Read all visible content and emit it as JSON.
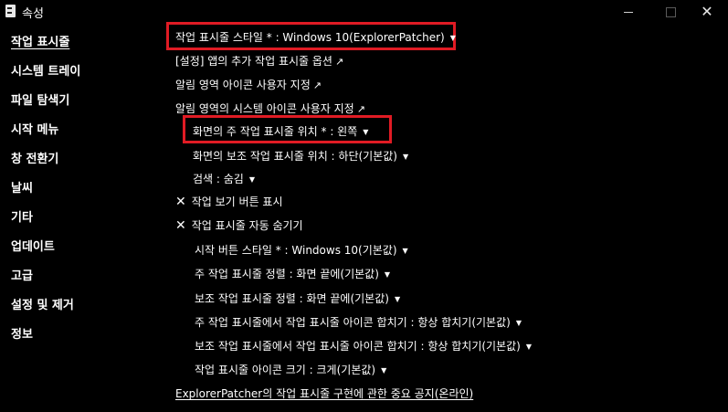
{
  "window": {
    "title": "속성",
    "close_glyph": "✕"
  },
  "sidebar": {
    "items": [
      {
        "label": "작업 표시줄",
        "active": true
      },
      {
        "label": "시스템 트레이"
      },
      {
        "label": "파일 탐색기"
      },
      {
        "label": "시작 메뉴"
      },
      {
        "label": "창 전환기"
      },
      {
        "label": "날씨"
      },
      {
        "label": "기타"
      },
      {
        "label": "업데이트"
      },
      {
        "label": "고급"
      },
      {
        "label": "설정 및 제거"
      },
      {
        "label": "정보"
      }
    ]
  },
  "options": {
    "taskbar_style": "작업 표시줄 스타일 * : Windows 10(ExplorerPatcher)",
    "app_taskbar_options": "[설정] 앱의 추가 작업 표시줄 옵션",
    "notification_icons": "알림 영역 아이콘 사용자 지정",
    "notification_system_icons": "알림 영역의 시스템 아이콘 사용자 지정",
    "primary_taskbar_position": "화면의 주 작업 표시줄 위치 * : 왼쪽",
    "secondary_taskbar_position": "화면의 보조 작업 표시줄 위치 : 하단(기본값)",
    "search": "검색 : 숨김",
    "task_view_button": "작업 보기 버튼 표시",
    "auto_hide_taskbar": "작업 표시줄 자동 숨기기",
    "start_button_style": "시작 버튼 스타일 * : Windows 10(기본값)",
    "primary_alignment": "주 작업 표시줄 정렬 : 화면 끝에(기본값)",
    "secondary_alignment": "보조 작업 표시줄 정렬 : 화면 끝에(기본값)",
    "primary_combine_icons": "주 작업 표시줄에서 작업 표시줄 아이콘 합치기 : 항상 합치기(기본값)",
    "secondary_combine_icons": "보조 작업 표시줄에서 작업 표시줄 아이콘 합치기 : 항상 합치기(기본값)",
    "icon_size": "작업 표시줄 아이콘 크기 : 크게(기본값)",
    "notice_link": "ExplorerPatcher의 작업 표시줄 구현에 관한 중요 공지(온라인)"
  },
  "glyphs": {
    "dropdown": "▼",
    "external_link": "↗",
    "checked_x": "✕"
  },
  "colors": {
    "background": "#000000",
    "text": "#ffffff",
    "highlight": "#e01b24"
  }
}
